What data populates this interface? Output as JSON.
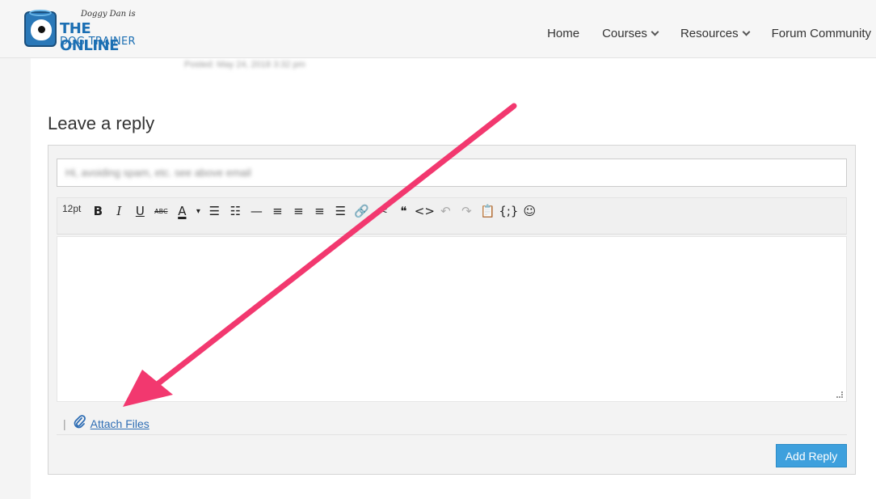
{
  "header": {
    "logo": {
      "small_text": "Doggy Dan is",
      "big_text": "THE ONLINE",
      "sub_text": "DOG TRAINER"
    },
    "nav": [
      {
        "label": "Home",
        "has_dropdown": false
      },
      {
        "label": "Courses",
        "has_dropdown": true
      },
      {
        "label": "Resources",
        "has_dropdown": true
      },
      {
        "label": "Forum Community",
        "has_dropdown": false
      }
    ]
  },
  "post": {
    "posted_text": "Posted: May 24, 2018 3:32 pm"
  },
  "reply": {
    "title": "Leave a reply",
    "email_value": "Hi, avoiding spam, etc. see above email",
    "toolbar": {
      "font_size": "12pt",
      "buttons": [
        {
          "name": "bold-button",
          "glyph": "B"
        },
        {
          "name": "italic-button",
          "glyph": "I"
        },
        {
          "name": "underline-button",
          "glyph": "U"
        },
        {
          "name": "strikethrough-button",
          "glyph": "ABC"
        },
        {
          "name": "text-color-button",
          "glyph": "A"
        },
        {
          "name": "text-color-dropdown",
          "glyph": "▾"
        },
        {
          "name": "bullet-list-button",
          "glyph": "☰"
        },
        {
          "name": "numbered-list-button",
          "glyph": "☷"
        },
        {
          "name": "horizontal-rule-button",
          "glyph": "—"
        },
        {
          "name": "align-left-button",
          "glyph": "≡"
        },
        {
          "name": "align-center-button",
          "glyph": "≡"
        },
        {
          "name": "align-right-button",
          "glyph": "≡"
        },
        {
          "name": "justify-button",
          "glyph": "☰"
        },
        {
          "name": "insert-link-button",
          "glyph": "🔗"
        },
        {
          "name": "unlink-button",
          "glyph": "✂"
        },
        {
          "name": "blockquote-button",
          "glyph": "❝"
        },
        {
          "name": "code-button",
          "glyph": "<>"
        },
        {
          "name": "undo-button",
          "glyph": "↶"
        },
        {
          "name": "redo-button",
          "glyph": "↷"
        },
        {
          "name": "paste-button",
          "glyph": "📋"
        },
        {
          "name": "source-code-button",
          "glyph": "{;}"
        },
        {
          "name": "emoji-button",
          "glyph": "☺"
        }
      ]
    },
    "attach_label": "Attach Files",
    "pipe": "|",
    "submit_label": "Add Reply"
  },
  "colors": {
    "accent": "#3ea0dd",
    "link": "#2e6db4",
    "arrow": "#f2386f"
  }
}
